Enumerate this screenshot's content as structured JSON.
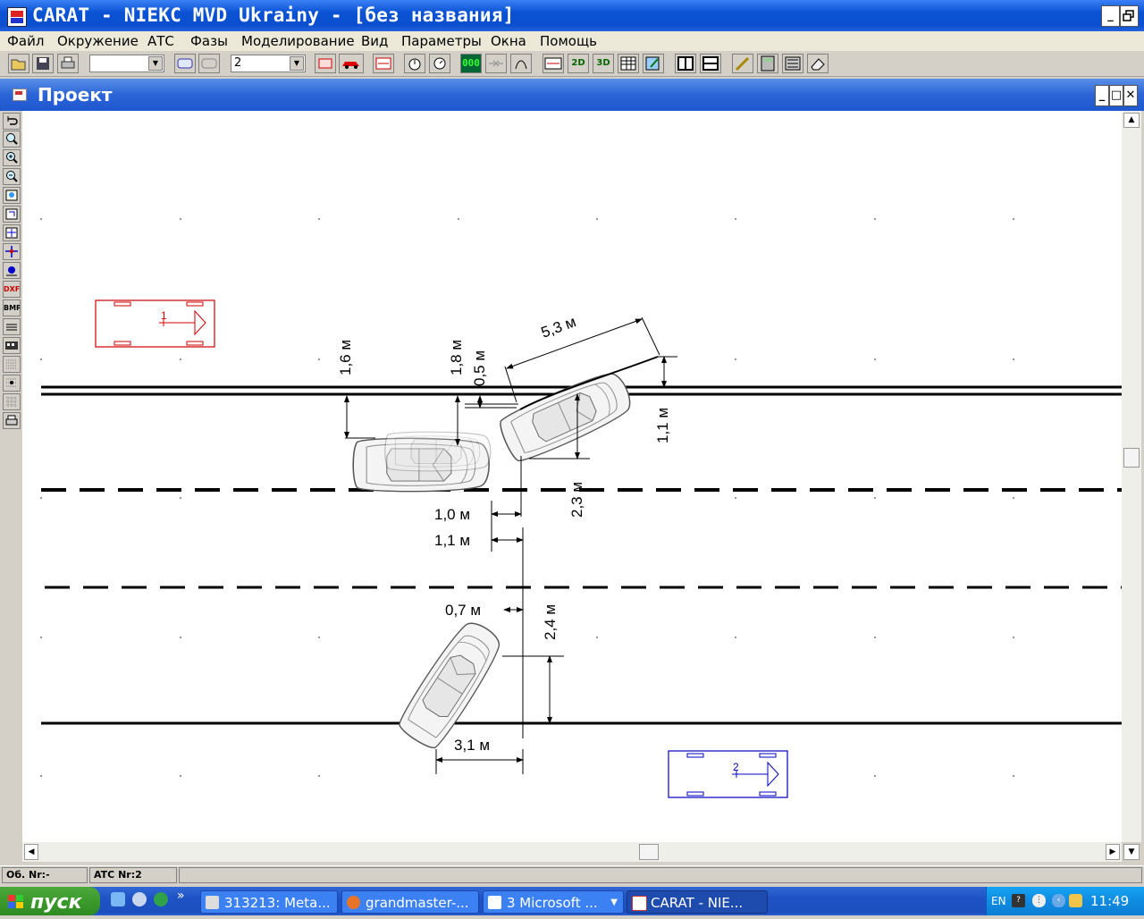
{
  "app": {
    "title": "CARAT - NIEKC MVD Ukrainy - [без названия]",
    "window_buttons": [
      "_",
      "🗗",
      "✕"
    ]
  },
  "menu": [
    "Файл",
    "Окружение",
    "АТС",
    "Фазы",
    "Моделирование",
    "Вид",
    "Параметры",
    "Окна",
    "Помощь"
  ],
  "toolbar": {
    "combo1_value": "",
    "combo2_value": "2",
    "btn_2d": "2D",
    "btn_3d": "3D",
    "btn_counter": "000"
  },
  "child": {
    "title": "Проект",
    "buttons": [
      "_",
      "□",
      "✕"
    ]
  },
  "left_tools": {
    "dxf": "DXF",
    "bmp": "BMP"
  },
  "colors": {
    "vehicle1": "#d00000",
    "vehicle2": "#0000c0",
    "road_line": "#000000"
  },
  "scene": {
    "vehicle1_label": "1",
    "vehicle2_label": "2",
    "dims": {
      "d_5_3": "5,3 м",
      "d_1_6": "1,6 м",
      "d_1_8": "1,8 м",
      "d_0_5": "0,5 м",
      "d_1_1v": "1,1 м",
      "d_2_3": "2,3 м",
      "d_1_0": "1,0 м",
      "d_1_1h": "1,1 м",
      "d_0_7": "0,7 м",
      "d_2_4": "2,4 м",
      "d_3_1": "3,1 м"
    }
  },
  "status": {
    "ob_nr": "Об. Nr:-",
    "ats_nr": "ATC Nr:2"
  },
  "taskbar": {
    "start": "пуск",
    "tasks": [
      "313213: Meta...",
      "grandmaster-...",
      "3 Microsoft ...",
      "CARAT - NIE..."
    ],
    "lang": "EN",
    "clock": "11:49"
  }
}
